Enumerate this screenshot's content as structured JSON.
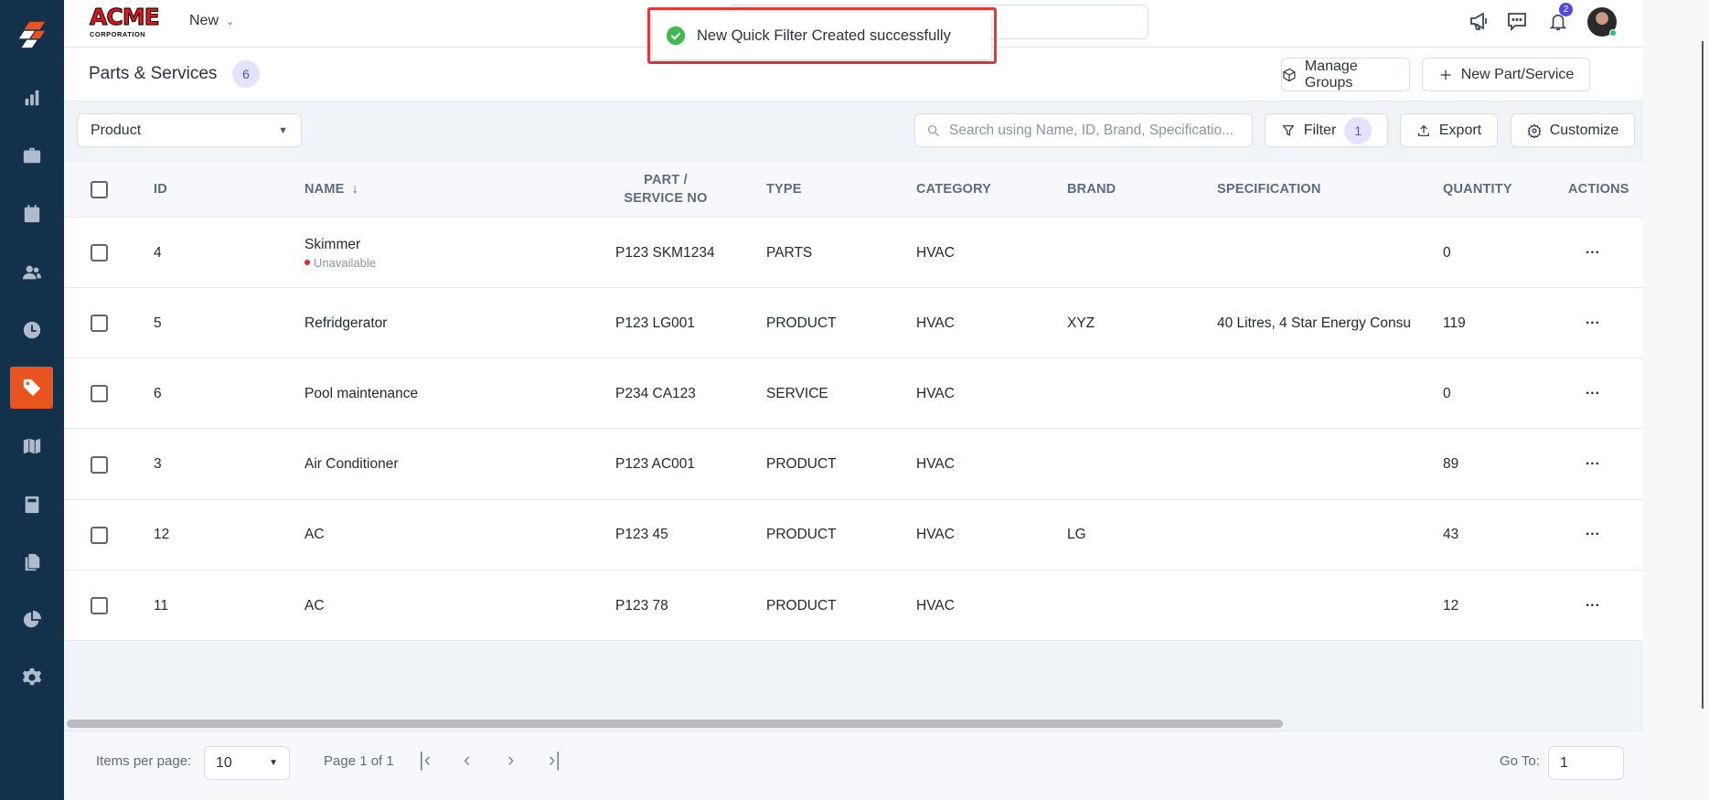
{
  "sidebar": {
    "items": [
      "logo",
      "reports",
      "jobs",
      "calendar",
      "customers",
      "timesheets",
      "parts-services",
      "map",
      "estimates",
      "documents",
      "analytics",
      "settings"
    ],
    "active": "parts-services",
    "accent": "#e8541e"
  },
  "topbar": {
    "brand": "ACME",
    "brand_sub": "CORPORATION",
    "new_label": "New",
    "notification_count": "2"
  },
  "toast": {
    "message": "New Quick Filter Created successfully"
  },
  "header": {
    "title": "Parts & Services",
    "count": "6",
    "manage_groups": "Manage Groups",
    "new_part": "New Part/Service"
  },
  "toolbar": {
    "type_select": "Product",
    "search_placeholder": "Search using Name, ID, Brand, Specificatio...",
    "filter": "Filter",
    "filter_count": "1",
    "export": "Export",
    "customize": "Customize"
  },
  "table": {
    "headers": {
      "id": "ID",
      "name": "NAME",
      "part_line1": "PART /",
      "part_line2": "SERVICE NO",
      "type": "TYPE",
      "category": "CATEGORY",
      "brand": "BRAND",
      "specification": "SPECIFICATION",
      "quantity": "QUANTITY",
      "actions": "ACTIONS"
    },
    "rows": [
      {
        "id": "4",
        "name": "Skimmer",
        "status": "Unavailable",
        "part": "P123 SKM1234",
        "type": "PARTS",
        "category": "HVAC",
        "brand": "",
        "spec": "",
        "qty": "0"
      },
      {
        "id": "5",
        "name": "Refridgerator",
        "status": "",
        "part": "P123 LG001",
        "type": "PRODUCT",
        "category": "HVAC",
        "brand": "XYZ",
        "spec": "40 Litres, 4 Star Energy Consu",
        "qty": "119"
      },
      {
        "id": "6",
        "name": "Pool maintenance",
        "status": "",
        "part": "P234 CA123",
        "type": "SERVICE",
        "category": "HVAC",
        "brand": "",
        "spec": "",
        "qty": "0"
      },
      {
        "id": "3",
        "name": "Air Conditioner",
        "status": "",
        "part": "P123 AC001",
        "type": "PRODUCT",
        "category": "HVAC",
        "brand": "",
        "spec": "",
        "qty": "89"
      },
      {
        "id": "12",
        "name": "AC",
        "status": "",
        "part": "P123 45",
        "type": "PRODUCT",
        "category": "HVAC",
        "brand": "LG",
        "spec": "",
        "qty": "43"
      },
      {
        "id": "11",
        "name": "AC",
        "status": "",
        "part": "P123 78",
        "type": "PRODUCT",
        "category": "HVAC",
        "brand": "",
        "spec": "",
        "qty": "12"
      }
    ],
    "actions_label": "..."
  },
  "footer": {
    "items_per_page_label": "Items per page:",
    "items_per_page": "10",
    "page_info": "Page 1 of 1",
    "goto_label": "Go To:",
    "goto_value": "1"
  }
}
